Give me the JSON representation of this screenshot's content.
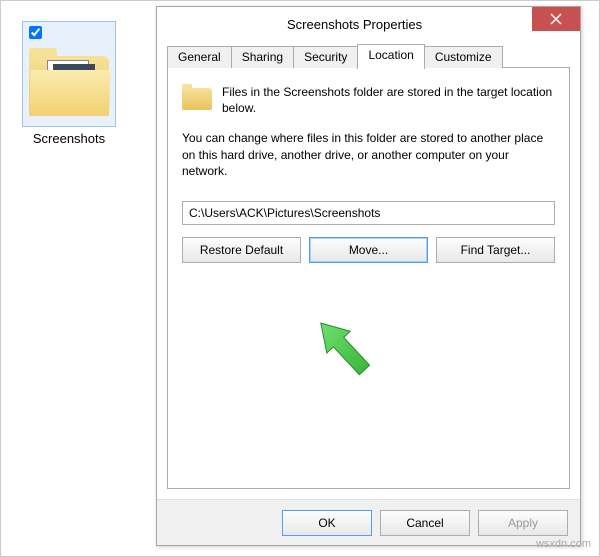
{
  "desktop": {
    "folder_name": "Screenshots"
  },
  "dialog": {
    "title": "Screenshots Properties",
    "tabs": [
      "General",
      "Sharing",
      "Security",
      "Location",
      "Customize"
    ],
    "active_tab": "Location",
    "info_text": "Files in the Screenshots folder are stored in the target location below.",
    "desc_text": "You can change where files in this folder are stored to another place on this hard drive, another drive, or another computer on your network.",
    "path_value": "C:\\Users\\ACK\\Pictures\\Screenshots",
    "buttons": {
      "restore": "Restore Default",
      "move": "Move...",
      "find": "Find Target..."
    },
    "footer": {
      "ok": "OK",
      "cancel": "Cancel",
      "apply": "Apply"
    }
  },
  "watermark": "wsxdn.com"
}
